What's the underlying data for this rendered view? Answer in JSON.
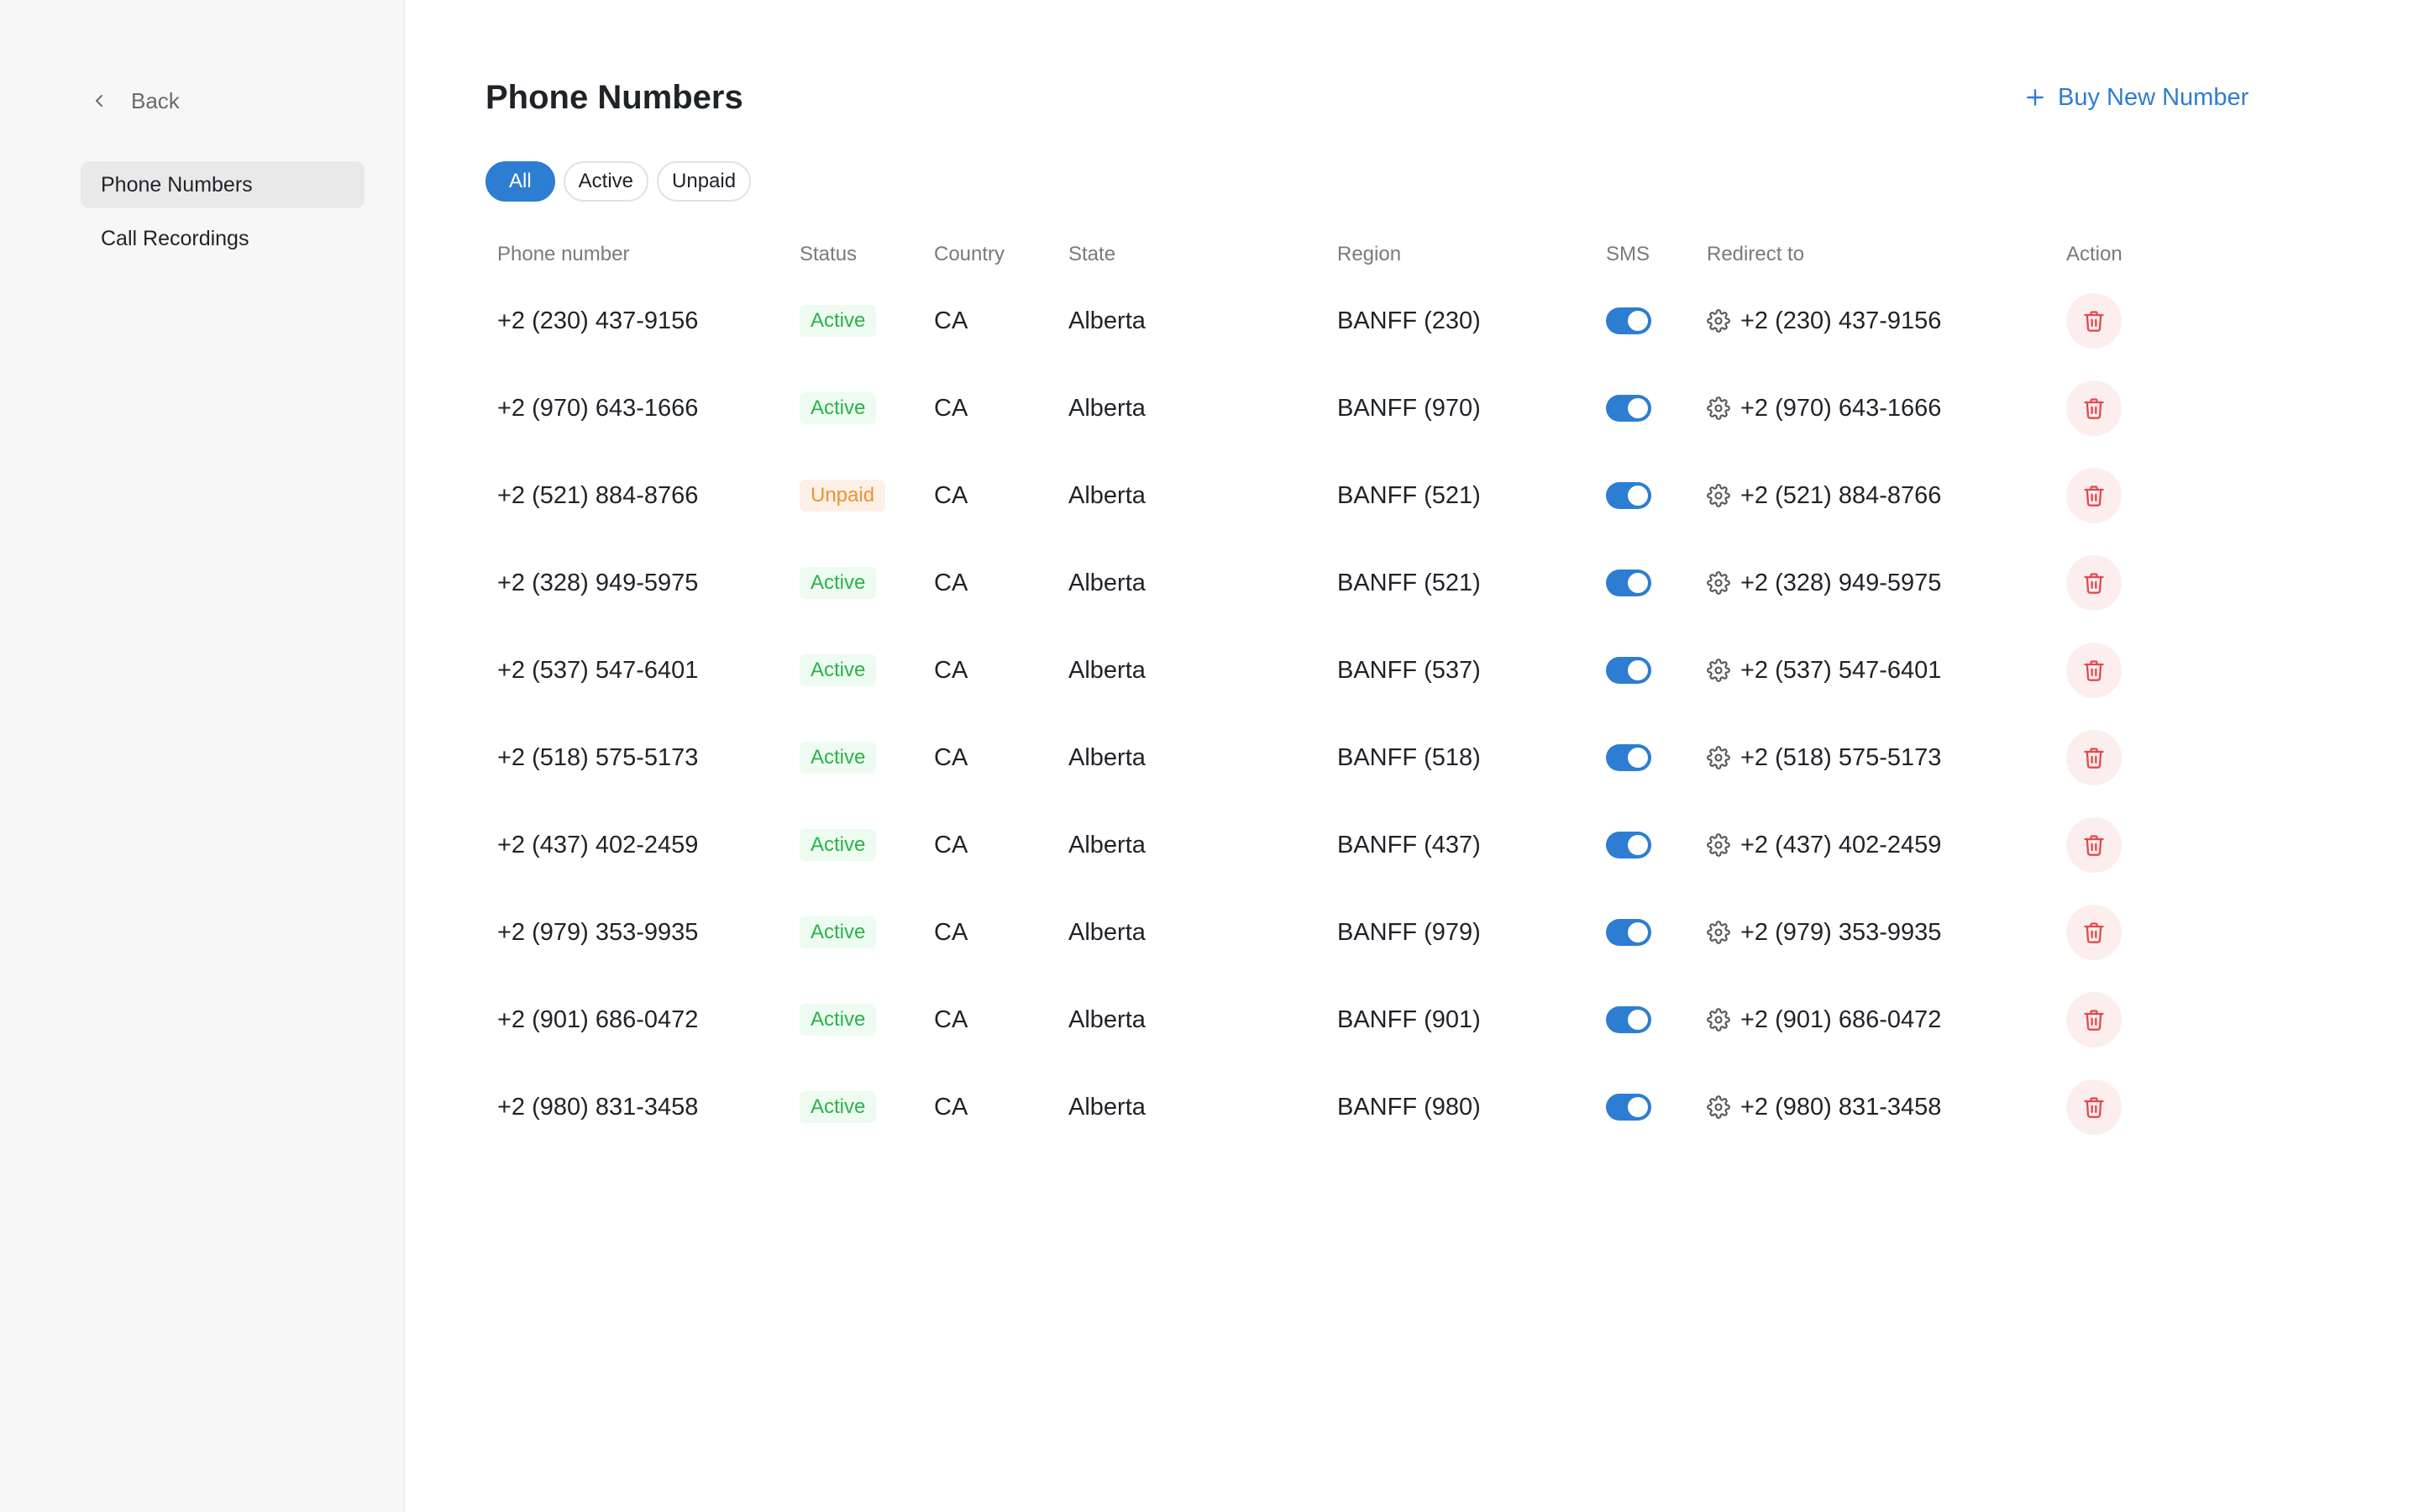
{
  "sidebar": {
    "back_label": "Back",
    "items": [
      {
        "label": "Phone Numbers",
        "active": true
      },
      {
        "label": "Call Recordings",
        "active": false
      }
    ]
  },
  "header": {
    "title": "Phone Numbers",
    "buy_button_label": "Buy New Number"
  },
  "filters": [
    {
      "label": "All",
      "active": true
    },
    {
      "label": "Active",
      "active": false
    },
    {
      "label": "Unpaid",
      "active": false
    }
  ],
  "table": {
    "columns": {
      "phone": "Phone number",
      "status": "Status",
      "country": "Country",
      "state": "State",
      "region": "Region",
      "sms": "SMS",
      "redirect": "Redirect to",
      "action": "Action"
    },
    "rows": [
      {
        "phone": "+2 (230) 437-9156",
        "status": "Active",
        "country": "CA",
        "state": "Alberta",
        "region": "BANFF (230)",
        "sms": true,
        "redirect": "+2 (230) 437-9156"
      },
      {
        "phone": "+2 (970) 643-1666",
        "status": "Active",
        "country": "CA",
        "state": "Alberta",
        "region": "BANFF (970)",
        "sms": true,
        "redirect": "+2 (970) 643-1666"
      },
      {
        "phone": "+2 (521) 884-8766",
        "status": "Unpaid",
        "country": "CA",
        "state": "Alberta",
        "region": "BANFF (521)",
        "sms": true,
        "redirect": "+2 (521) 884-8766"
      },
      {
        "phone": "+2 (328) 949-5975",
        "status": "Active",
        "country": "CA",
        "state": "Alberta",
        "region": "BANFF (521)",
        "sms": true,
        "redirect": "+2 (328) 949-5975"
      },
      {
        "phone": "+2 (537) 547-6401",
        "status": "Active",
        "country": "CA",
        "state": "Alberta",
        "region": "BANFF (537)",
        "sms": true,
        "redirect": "+2 (537) 547-6401"
      },
      {
        "phone": "+2 (518) 575-5173",
        "status": "Active",
        "country": "CA",
        "state": "Alberta",
        "region": "BANFF (518)",
        "sms": true,
        "redirect": "+2 (518) 575-5173"
      },
      {
        "phone": "+2 (437) 402-2459",
        "status": "Active",
        "country": "CA",
        "state": "Alberta",
        "region": "BANFF (437)",
        "sms": true,
        "redirect": "+2 (437) 402-2459"
      },
      {
        "phone": "+2 (979) 353-9935",
        "status": "Active",
        "country": "CA",
        "state": "Alberta",
        "region": "BANFF (979)",
        "sms": true,
        "redirect": "+2 (979) 353-9935"
      },
      {
        "phone": "+2 (901) 686-0472",
        "status": "Active",
        "country": "CA",
        "state": "Alberta",
        "region": "BANFF (901)",
        "sms": true,
        "redirect": "+2 (901) 686-0472"
      },
      {
        "phone": "+2 (980) 831-3458",
        "status": "Active",
        "country": "CA",
        "state": "Alberta",
        "region": "BANFF (980)",
        "sms": true,
        "redirect": "+2 (980) 831-3458"
      }
    ]
  },
  "colors": {
    "accent": "#2d7dd2",
    "active_badge_text": "#29b34a",
    "unpaid_badge_text": "#f0922e",
    "delete": "#e5484d"
  },
  "icons": {
    "back": "chevron-left-icon",
    "buy": "plus-icon",
    "redirect": "gear-icon",
    "delete": "trash-icon"
  }
}
